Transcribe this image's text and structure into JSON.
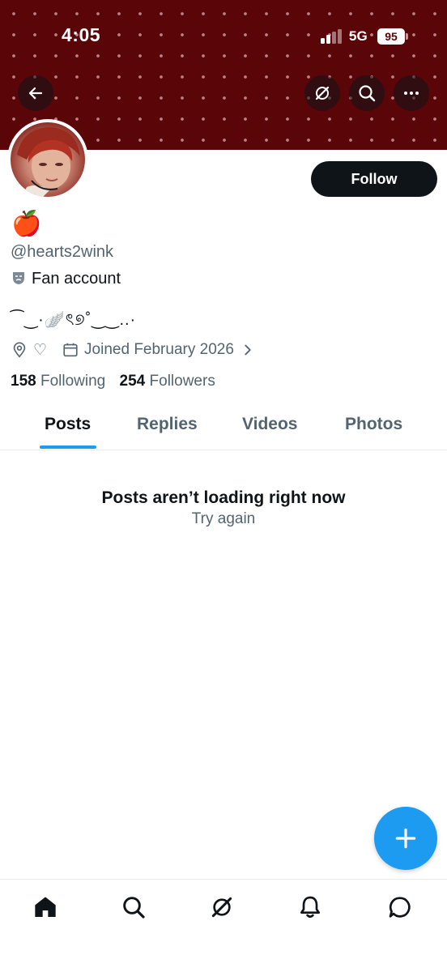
{
  "status_bar": {
    "time": "4:05",
    "network": "5G",
    "battery": "95"
  },
  "profile": {
    "display_name": "🍎",
    "handle": "@hearts2wink",
    "bio": "Fan account",
    "bio_decoration": "⁀‿·🪽ৎ୭˚‿‿..·",
    "location": "♡",
    "joined": "Joined February 2026",
    "following_count": "158",
    "following_label": "Following",
    "followers_count": "254",
    "followers_label": "Followers",
    "follow_label": "Follow"
  },
  "tabs": [
    "Posts",
    "Replies",
    "Videos",
    "Photos"
  ],
  "active_tab": "Posts",
  "feed": {
    "error_title": "Posts aren’t loading right now",
    "retry_label": "Try again"
  },
  "icons": {
    "back": "arrow-left-icon",
    "grok": "grok-icon",
    "search": "search-icon",
    "more": "more-icon",
    "compose": "plus-icon",
    "nav": [
      "home-icon",
      "search-icon",
      "grok-icon",
      "bell-icon",
      "message-icon"
    ]
  },
  "colors": {
    "accent": "#1d9bf0",
    "banner": "#5a0508",
    "text": "#0f1419",
    "muted": "#536471"
  }
}
